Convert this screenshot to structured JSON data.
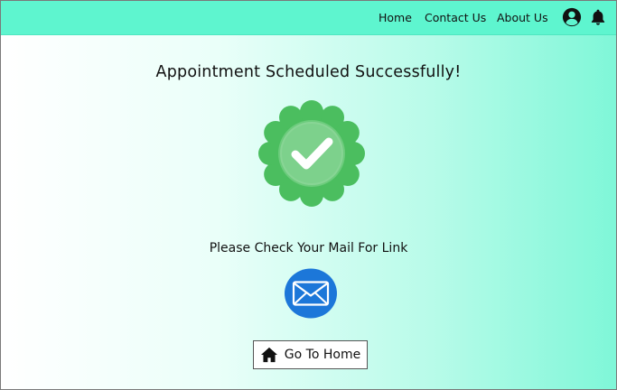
{
  "navbar": {
    "links": [
      "Home",
      "Contact Us",
      "About Us"
    ],
    "icons": [
      "user-circle-icon",
      "bell-icon"
    ]
  },
  "main": {
    "title": "Appointment Scheduled Successfully!",
    "badge_icon": "success-badge-checkmark-icon",
    "subtitle": "Please Check Your Mail For Link",
    "mail_icon": "envelope-icon",
    "home_button_label": "Go To Home",
    "home_button_icon": "home-icon"
  },
  "colors": {
    "navbar": "#5ef5cf",
    "badge": "#4bbe5f",
    "mail": "#1c77d9"
  }
}
